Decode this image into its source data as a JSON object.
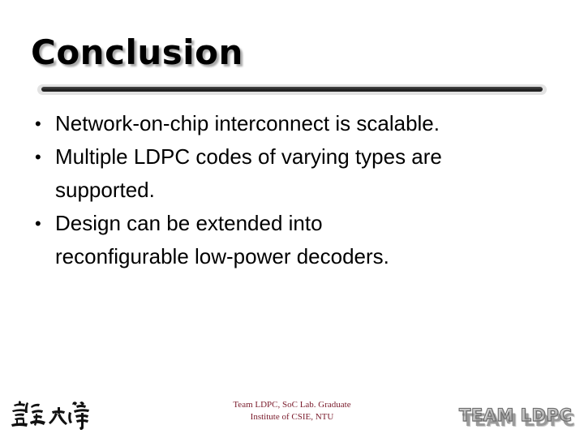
{
  "slide": {
    "title": "Conclusion",
    "bullets": [
      {
        "marker": "•",
        "text": "Network-on-chip interconnect is scalable."
      },
      {
        "marker": "•",
        "text": "Multiple LDPC codes of varying types are\nsupported."
      },
      {
        "marker": "•",
        "text": "Design can be extended into\nreconfigurable low-power decoders."
      }
    ]
  },
  "footer": {
    "credit": "Team LDPC, SoC Lab. Graduate\nInstitute of CSIE, NTU",
    "credit_color": "#7a1c2c",
    "left_logo_name": "ntu-calligraphy-logo",
    "left_logo_text": "臺灣大學",
    "right_logo_text": "TEAM LDPC"
  },
  "colors": {
    "background": "#ffffff",
    "text": "#000000",
    "divider_bar": "#262626",
    "divider_shadow": "#e2e2e2",
    "title_shadow": "#8c8c8c",
    "footer_credit": "#7a1c2c",
    "logo_gray": "#9a9a9a"
  }
}
